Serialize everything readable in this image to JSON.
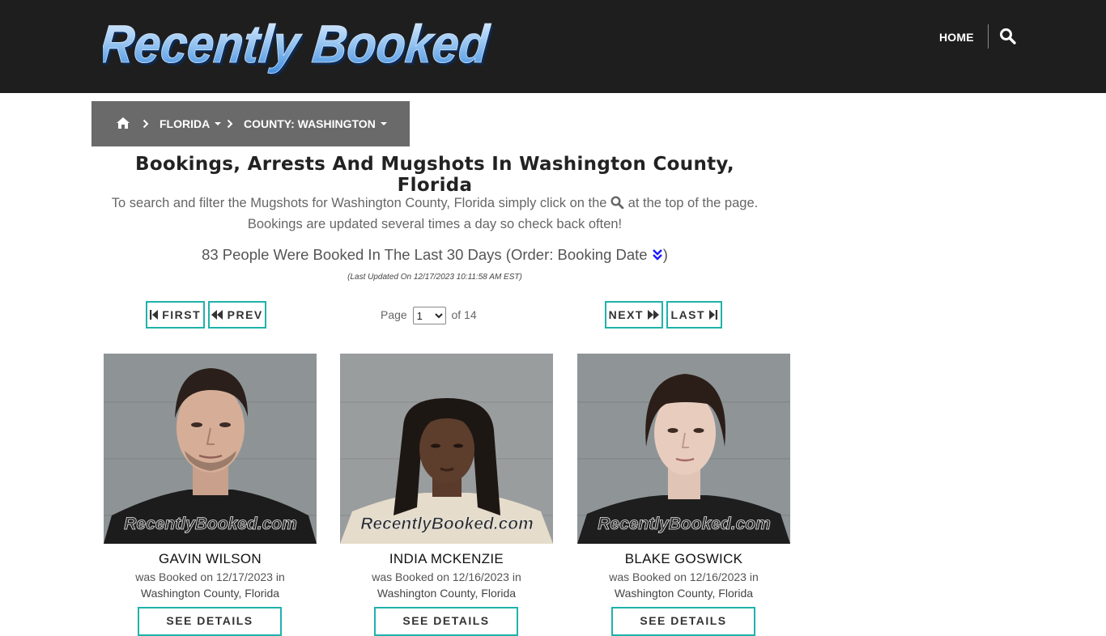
{
  "header": {
    "logo_text": "Recently Booked",
    "nav_home": "HOME",
    "search_icon": "search-icon"
  },
  "breadcrumb": {
    "home_icon": "home-icon",
    "state": "FLORIDA",
    "county": "COUNTY: WASHINGTON"
  },
  "main": {
    "title": "Bookings, Arrests And Mugshots In Washington County, Florida",
    "intro_before": "To search and filter the Mugshots for Washington County, Florida simply click on the",
    "intro_after": "at the top of the page.",
    "intro_line2": "Bookings are updated several times a day so check back often!",
    "count_text": "83 People Were Booked In The Last 30 Days (Order: Booking Date",
    "count_close": ")",
    "last_updated": "(Last Updated On 12/17/2023 10:11:58 AM EST)"
  },
  "pager": {
    "first": "FIRST",
    "prev": "PREV",
    "next": "NEXT",
    "last": "LAST",
    "page_label": "Page",
    "page_value": "1",
    "of_label": "of 14"
  },
  "bookings": [
    {
      "name": "GAVIN WILSON",
      "booked": "was Booked on 12/17/2023 in",
      "county": "Washington County, Florida",
      "watermark": "RecentlyBooked.com",
      "details": "SEE DETAILS"
    },
    {
      "name": "INDIA MCKENZIE",
      "booked": "was Booked on 12/16/2023 in",
      "county": "Washington County, Florida",
      "watermark": "RecentlyBooked.com",
      "details": "SEE DETAILS"
    },
    {
      "name": "BLAKE GOSWICK",
      "booked": "was Booked on 12/16/2023 in",
      "county": "Washington County, Florida",
      "watermark": "RecentlyBooked.com",
      "details": "SEE DETAILS"
    }
  ],
  "colors": {
    "header_bg": "#1e1e1e",
    "breadcrumb_bg": "#6a6a6a",
    "accent": "#20b2aa",
    "sort_icon": "#1a1aff"
  }
}
